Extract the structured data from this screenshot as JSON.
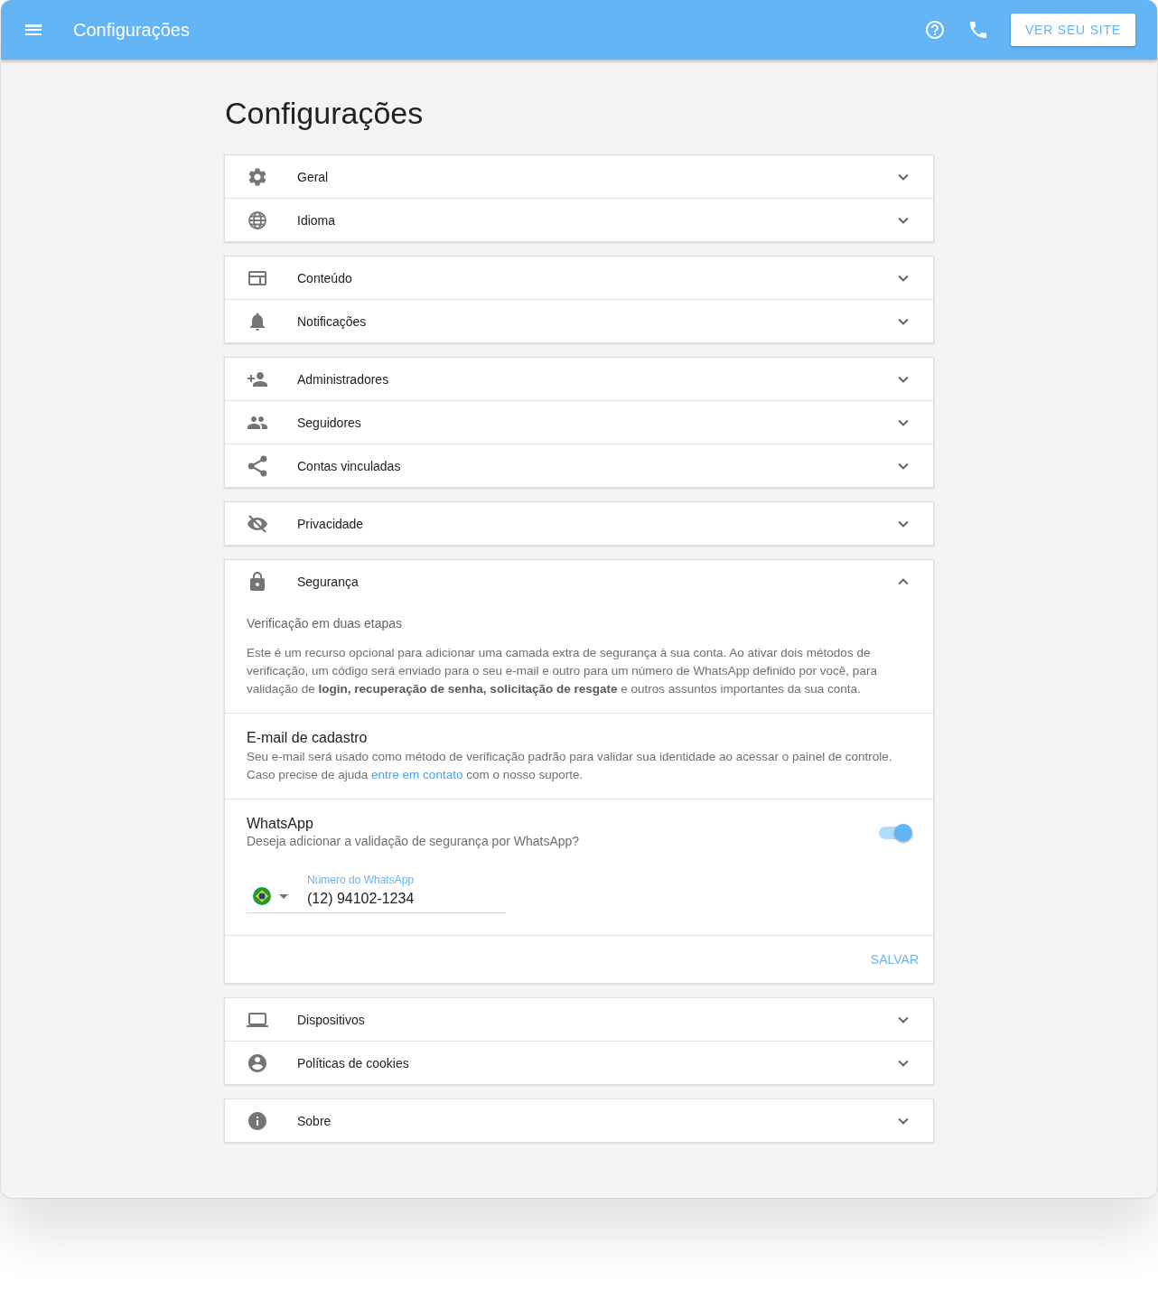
{
  "app_bar": {
    "title": "Configurações",
    "site_button": "VER SEU SITE"
  },
  "page_title": "Configurações",
  "groups": [
    {
      "items": [
        {
          "kind": "gear",
          "label": "Geral",
          "expanded": false
        },
        {
          "kind": "globe",
          "label": "Idioma",
          "expanded": false
        }
      ]
    },
    {
      "items": [
        {
          "kind": "web",
          "label": "Conteúdo",
          "expanded": false
        },
        {
          "kind": "bell",
          "label": "Notificações",
          "expanded": false
        }
      ]
    },
    {
      "items": [
        {
          "kind": "person-add",
          "label": "Administradores",
          "expanded": false
        },
        {
          "kind": "people",
          "label": "Seguidores",
          "expanded": false
        },
        {
          "kind": "share",
          "label": "Contas vinculadas",
          "expanded": false
        }
      ]
    },
    {
      "items": [
        {
          "kind": "eye-off",
          "label": "Privacidade",
          "expanded": false
        }
      ]
    },
    {
      "items": [
        {
          "kind": "lock",
          "label": "Segurança",
          "expanded": true,
          "details": {
            "intro": {
              "title": "Verificação em duas etapas",
              "text": "Este é um recurso opcional para adicionar uma camada extra de segurança à sua conta. Ao ativar dois métodos de verificação, um código será enviado para o seu e-mail e outro para um número de WhatsApp definido por você, para validação de **login, recuperação de senha, solicitação de resgate** e outros assuntos importantes da sua conta."
            },
            "email": {
              "title": "E-mail de cadastro",
              "text_before": "Seu e-mail será usado como método de verificação padrão para validar sua identidade ao acessar o painel de controle. Caso precise de ajuda ",
              "link": "entre em contato",
              "text_after": " com o nosso suporte."
            },
            "whatsapp": {
              "title": "WhatsApp",
              "subtitle": "Deseja adicionar a validação de segurança por WhatsApp?",
              "on": true,
              "field_label": "Número do WhatsApp",
              "value": "(12) 94102-1234"
            },
            "save_button": "SALVAR"
          }
        }
      ]
    },
    {
      "items": [
        {
          "kind": "laptop",
          "label": "Dispositivos",
          "expanded": false
        },
        {
          "kind": "account",
          "label": "Políticas de cookies",
          "expanded": false
        }
      ]
    },
    {
      "items": [
        {
          "kind": "info",
          "label": "Sobre",
          "expanded": false
        }
      ]
    }
  ]
}
